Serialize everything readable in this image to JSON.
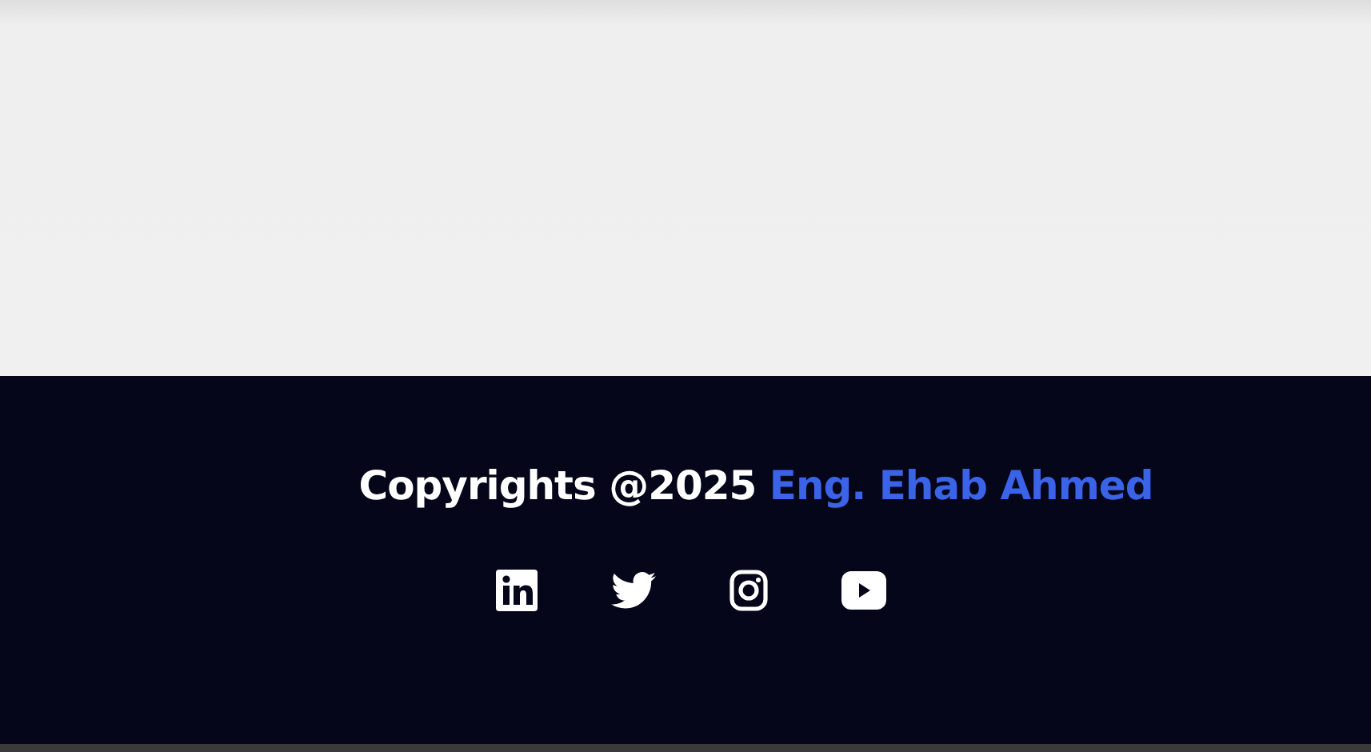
{
  "footer": {
    "copyright": "Copyrights @2025",
    "author": "Eng. Ehab Ahmed",
    "social_links": [
      {
        "kind": "linkedin"
      },
      {
        "kind": "twitter"
      },
      {
        "kind": "instagram"
      },
      {
        "kind": "youtube"
      }
    ]
  }
}
